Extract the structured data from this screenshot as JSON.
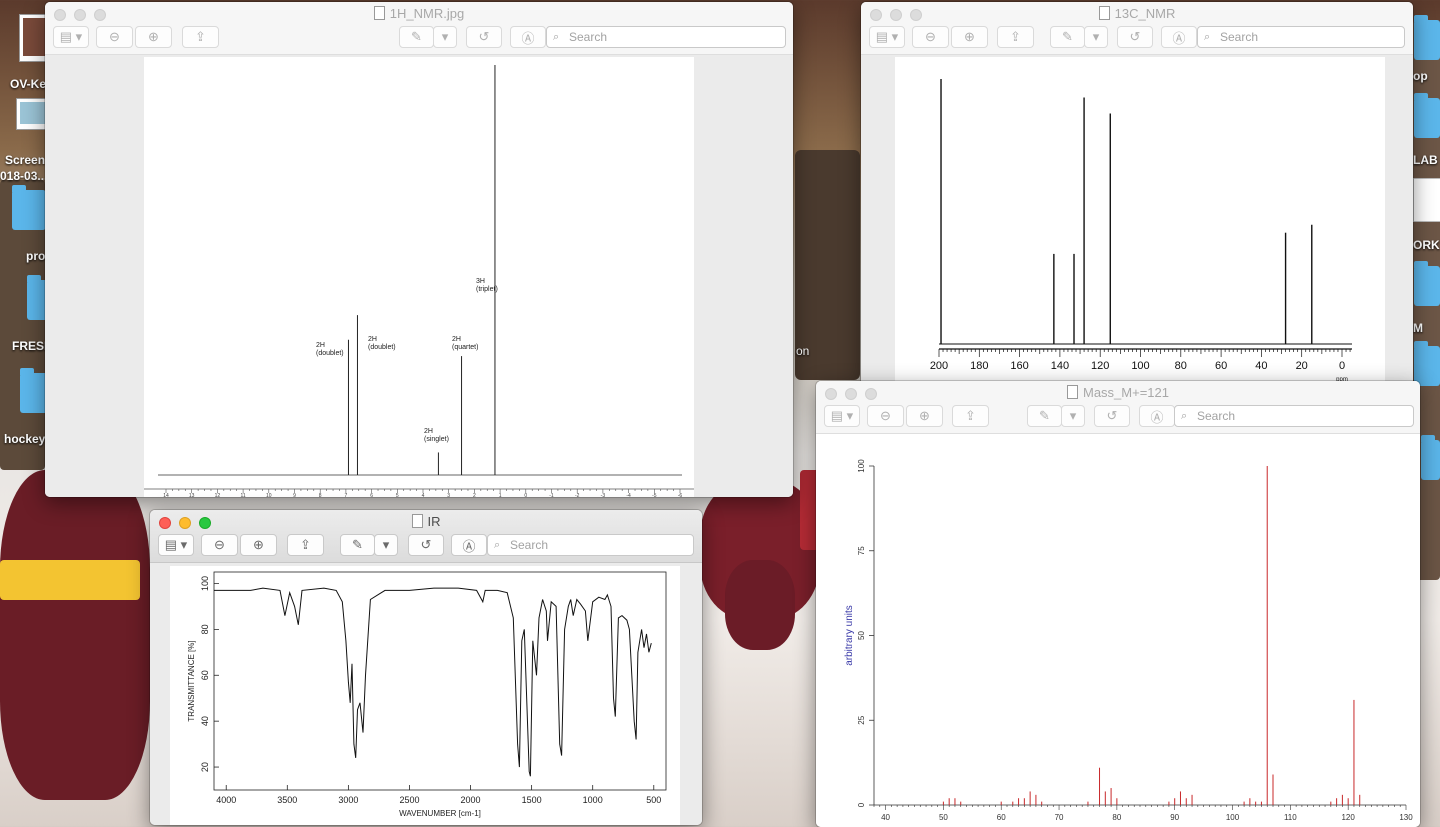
{
  "desktop": {
    "items": [
      {
        "label": "OV-Ke"
      },
      {
        "label": "Screen"
      },
      {
        "label": "018-03..."
      },
      {
        "label": "pro"
      },
      {
        "label": "FRESH"
      },
      {
        "label": "hockey"
      },
      {
        "label": "op"
      },
      {
        "label": "LAB"
      },
      {
        "label": "ORK"
      },
      {
        "label": "M"
      },
      {
        "label": "on"
      }
    ]
  },
  "toolbar": {
    "search_placeholder": "Search"
  },
  "windows": {
    "h1nmr": {
      "title": "1H_NMR.jpg",
      "peak_labels": [
        {
          "mult": "2H",
          "type": "(doublet)"
        },
        {
          "mult": "2H",
          "type": "(doublet)"
        },
        {
          "mult": "2H",
          "type": "(singlet)"
        },
        {
          "mult": "2H",
          "type": "(quartet)"
        },
        {
          "mult": "3H",
          "type": "(triplet)"
        }
      ],
      "x_ticks": [
        "14",
        "13",
        "12",
        "11",
        "10",
        "9",
        "8",
        "7",
        "6",
        "5",
        "4",
        "3",
        "2",
        "1",
        "0",
        "-1",
        "-2",
        "-3",
        "-4",
        "-5",
        "-6"
      ]
    },
    "c13nmr": {
      "title": "13C_NMR",
      "x_ticks": [
        "200",
        "180",
        "160",
        "140",
        "120",
        "100",
        "80",
        "60",
        "40",
        "20",
        "0"
      ],
      "x_unit": "ppm"
    },
    "ir": {
      "title": "IR",
      "ylabel": "TRANSMITTANCE [%]",
      "xlabel": "WAVENUMBER [cm-1]",
      "y_ticks": [
        "20",
        "40",
        "60",
        "80",
        "100"
      ],
      "x_ticks": [
        "4000",
        "3500",
        "3000",
        "2500",
        "2000",
        "1500",
        "1000",
        "500"
      ]
    },
    "mass": {
      "title": "Mass_M+=121",
      "ylabel": "arbitrary units",
      "y_ticks": [
        "0",
        "25",
        "50",
        "75",
        "100"
      ],
      "x_ticks": [
        "40",
        "50",
        "60",
        "70",
        "80",
        "90",
        "100",
        "110",
        "120",
        "130"
      ]
    }
  },
  "chart_data": [
    {
      "type": "line",
      "title": "1H_NMR.jpg",
      "xlabel": "",
      "ylabel": "",
      "xlim": [
        14,
        -6
      ],
      "peaks": [
        {
          "ppm": 6.9,
          "height": 0.33,
          "label": "2H (doublet)"
        },
        {
          "ppm": 6.55,
          "height": 0.39,
          "label": "2H (doublet)"
        },
        {
          "ppm": 3.4,
          "height": 0.055,
          "label": "2H (singlet)"
        },
        {
          "ppm": 2.5,
          "height": 0.29,
          "label": "2H (quartet)"
        },
        {
          "ppm": 1.2,
          "height": 1.0,
          "label": "3H (triplet)"
        }
      ]
    },
    {
      "type": "bar",
      "title": "13C_NMR",
      "xlabel": "ppm",
      "ylabel": "",
      "xlim": [
        200,
        0
      ],
      "peaks": [
        {
          "ppm": 199,
          "height": 1.0
        },
        {
          "ppm": 143,
          "height": 0.34
        },
        {
          "ppm": 133,
          "height": 0.34
        },
        {
          "ppm": 128,
          "height": 0.93
        },
        {
          "ppm": 115,
          "height": 0.87
        },
        {
          "ppm": 28,
          "height": 0.42
        },
        {
          "ppm": 15,
          "height": 0.45
        }
      ]
    },
    {
      "type": "line",
      "title": "IR",
      "xlabel": "WAVENUMBER [cm-1]",
      "ylabel": "TRANSMITTANCE [%]",
      "xlim": [
        4000,
        500
      ],
      "ylim": [
        10,
        105
      ],
      "points": [
        [
          4100,
          97
        ],
        [
          3800,
          97
        ],
        [
          3700,
          98
        ],
        [
          3560,
          97
        ],
        [
          3520,
          86
        ],
        [
          3480,
          96
        ],
        [
          3440,
          90
        ],
        [
          3410,
          82
        ],
        [
          3380,
          97
        ],
        [
          3200,
          98
        ],
        [
          3100,
          97
        ],
        [
          3050,
          92
        ],
        [
          3020,
          75
        ],
        [
          3000,
          57
        ],
        [
          2985,
          48
        ],
        [
          2970,
          65
        ],
        [
          2955,
          30
        ],
        [
          2940,
          24
        ],
        [
          2925,
          45
        ],
        [
          2905,
          48
        ],
        [
          2880,
          35
        ],
        [
          2860,
          60
        ],
        [
          2820,
          93
        ],
        [
          2700,
          97
        ],
        [
          2500,
          97
        ],
        [
          2300,
          98
        ],
        [
          2100,
          98
        ],
        [
          1950,
          97
        ],
        [
          1900,
          92
        ],
        [
          1880,
          97
        ],
        [
          1780,
          97
        ],
        [
          1700,
          96
        ],
        [
          1650,
          85
        ],
        [
          1615,
          30
        ],
        [
          1600,
          20
        ],
        [
          1580,
          75
        ],
        [
          1560,
          80
        ],
        [
          1520,
          18
        ],
        [
          1510,
          16
        ],
        [
          1490,
          75
        ],
        [
          1460,
          60
        ],
        [
          1440,
          85
        ],
        [
          1410,
          93
        ],
        [
          1380,
          88
        ],
        [
          1370,
          75
        ],
        [
          1340,
          92
        ],
        [
          1300,
          90
        ],
        [
          1270,
          30
        ],
        [
          1255,
          25
        ],
        [
          1230,
          80
        ],
        [
          1200,
          90
        ],
        [
          1180,
          93
        ],
        [
          1160,
          86
        ],
        [
          1130,
          93
        ],
        [
          1100,
          91
        ],
        [
          1060,
          88
        ],
        [
          1040,
          75
        ],
        [
          1000,
          92
        ],
        [
          950,
          94
        ],
        [
          900,
          93
        ],
        [
          880,
          95
        ],
        [
          850,
          90
        ],
        [
          830,
          50
        ],
        [
          815,
          42
        ],
        [
          790,
          85
        ],
        [
          760,
          86
        ],
        [
          720,
          84
        ],
        [
          700,
          80
        ],
        [
          680,
          60
        ],
        [
          660,
          40
        ],
        [
          645,
          32
        ],
        [
          630,
          70
        ],
        [
          600,
          80
        ],
        [
          580,
          72
        ],
        [
          560,
          78
        ],
        [
          540,
          70
        ],
        [
          520,
          74
        ]
      ]
    },
    {
      "type": "bar",
      "title": "Mass_M+=121",
      "xlabel": "",
      "ylabel": "arbitrary units",
      "xlim": [
        38,
        130
      ],
      "ylim": [
        0,
        100
      ],
      "x": [
        50,
        51,
        52,
        53,
        60,
        62,
        63,
        64,
        65,
        66,
        67,
        75,
        77,
        78,
        79,
        80,
        89,
        90,
        91,
        92,
        93,
        102,
        103,
        104,
        105,
        106,
        107,
        117,
        118,
        119,
        120,
        121,
        122
      ],
      "values": [
        1,
        2,
        2,
        1,
        1,
        1,
        2,
        2,
        4,
        3,
        1,
        1,
        11,
        4,
        5,
        2,
        1,
        2,
        4,
        2,
        3,
        1,
        2,
        1,
        1,
        100,
        9,
        1,
        2,
        3,
        2,
        31,
        3
      ]
    }
  ]
}
